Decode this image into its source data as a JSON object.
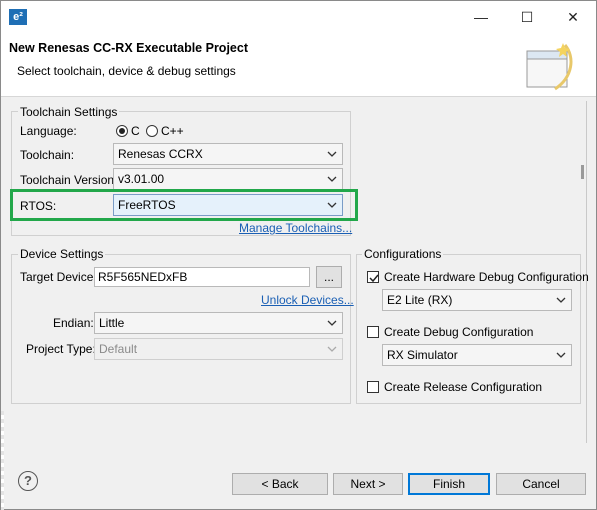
{
  "window": {
    "icon_text": "e²",
    "minimize_glyph": "—",
    "maximize_glyph": "☐",
    "close_glyph": "✕"
  },
  "header": {
    "title": "New Renesas CC-RX Executable Project",
    "subtitle": "Select toolchain, device & debug settings",
    "art_icon": "wizard-banner-icon"
  },
  "toolchain_settings": {
    "group_label": "Toolchain Settings",
    "language_label": "Language:",
    "language_options": [
      {
        "label": "C",
        "checked": true
      },
      {
        "label": "C++",
        "checked": false
      }
    ],
    "toolchain_label": "Toolchain:",
    "toolchain_value": "Renesas CCRX",
    "version_label": "Toolchain Version:",
    "version_value": "v3.01.00",
    "rtos_label": "RTOS:",
    "rtos_value": "FreeRTOS",
    "manage_link": "Manage Toolchains...",
    "highlight_color": "#22a74a"
  },
  "device_settings": {
    "group_label": "Device Settings",
    "target_label": "Target Device:",
    "target_value": "R5F565NEDxFB",
    "browse_label": "...",
    "unlock_link": "Unlock Devices...",
    "endian_label": "Endian:",
    "endian_value": "Little",
    "project_type_label": "Project Type:",
    "project_type_value": "Default"
  },
  "configurations": {
    "group_label": "Configurations",
    "hw_debug_label": "Create Hardware Debug Configuration",
    "hw_debug_checked": true,
    "hw_debug_tool": "E2 Lite (RX)",
    "debug_label": "Create Debug Configuration",
    "debug_checked": false,
    "debug_tool": "RX Simulator",
    "release_label": "Create Release Configuration",
    "release_checked": false
  },
  "footer": {
    "help_glyph": "?",
    "back_label": "< Back",
    "next_label": "Next >",
    "finish_label": "Finish",
    "cancel_label": "Cancel"
  },
  "colors": {
    "link": "#1a5fb4",
    "default_button_border": "#0078d7"
  }
}
